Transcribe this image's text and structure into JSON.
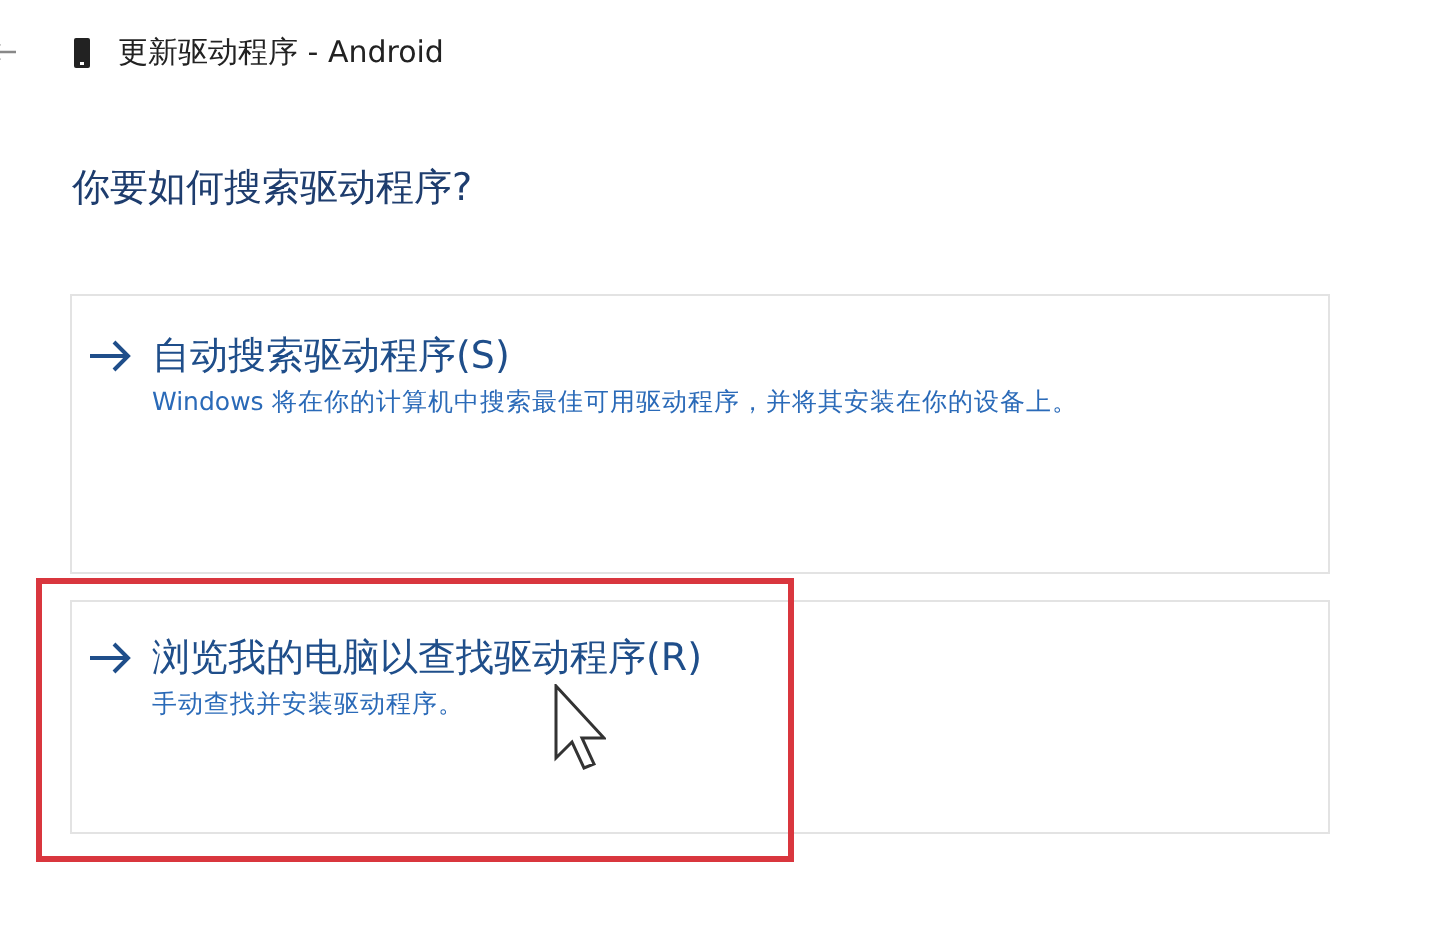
{
  "window": {
    "title": "更新驱动程序 - Android"
  },
  "heading": "你要如何搜索驱动程序?",
  "options": [
    {
      "title": "自动搜索驱动程序(S)",
      "description": "Windows 将在你的计算机中搜索最佳可用驱动程序，并将其安装在你的设备上。",
      "highlighted": false
    },
    {
      "title": "浏览我的电脑以查找驱动程序(R)",
      "description": "手动查找并安装驱动程序。",
      "highlighted": true
    }
  ]
}
